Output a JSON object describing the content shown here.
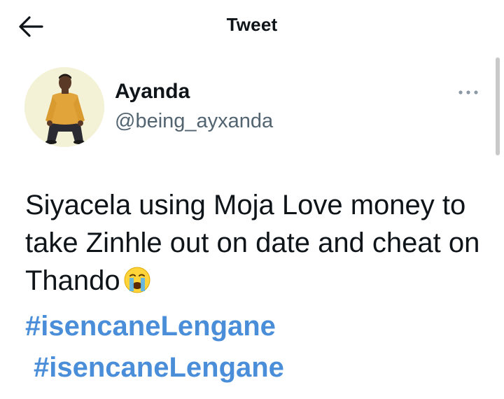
{
  "header": {
    "title": "Tweet"
  },
  "author": {
    "name": "Ayanda",
    "handle": "@being_ayxanda"
  },
  "tweet": {
    "text": "Siyacela using Moja Love money to take Zinhle out on date and cheat on Thando",
    "emoji": "crying-face",
    "hashtags": [
      "#isencaneLengane",
      "#isencaneLengane"
    ]
  },
  "colors": {
    "link": "#4a8ed9",
    "secondary_text": "#536471",
    "avatar_bg": "#f3f1d6"
  },
  "icons": {
    "back": "arrow-left-icon",
    "more": "more-dots-icon"
  }
}
